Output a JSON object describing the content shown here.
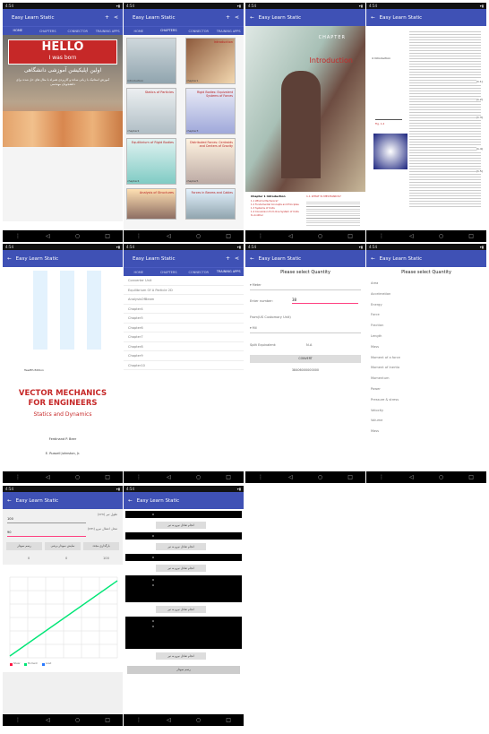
{
  "app": {
    "title": "Easy Learn Static"
  },
  "status": {
    "time": "4:54",
    "right": "▾▮"
  },
  "tabs": [
    "HOME",
    "CHAPTERS",
    "CONNECTOR",
    "TRAINING APPS"
  ],
  "home": {
    "banner_title": "HELLO",
    "banner_subtitle": "I was born",
    "farsi_title": "اولین اپلیکیشن آموزشی دانشگاهی",
    "farsi_body": "آموزش استاتیک با زبانی ساده و کاربردی همراه با مثال های حل شده برای دانشجویان مهندسی"
  },
  "chapters": {
    "items": [
      {
        "label": "Introduction",
        "cap": "chapter1"
      },
      {
        "label": "",
        "cap": "introduction"
      },
      {
        "label": "Statics of Particles",
        "cap": "chapter2"
      },
      {
        "label": "Rigid Bodies: Equivalent Systems of Forces",
        "cap": "chapter3"
      },
      {
        "label": "Equilibrium of Rigid Bodies",
        "cap": "chapter4"
      },
      {
        "label": "Distributed Forces: Centroids and Centers of Gravity",
        "cap": "chapter5"
      },
      {
        "label": "Analysis of Structures",
        "cap": "chapter6"
      },
      {
        "label": "Forces in Beams and Cables",
        "cap": "chapter7"
      }
    ]
  },
  "intro": {
    "chapter_word": "CHAPTER",
    "heading": "Introduction",
    "contents_title": "Chapter 1 Introduction",
    "contents": [
      "1.1 What Is Mechanics?",
      "1.2 Fundamental Concepts and Principles",
      "1.3 Systems of Units",
      "1.4 Conversion from One System of Units to Another"
    ],
    "section": "1.1 WHAT IS MECHANICS?"
  },
  "page4": {
    "running_head": "4   Introduction",
    "eq1": "(1.1)",
    "eq2": "(1.2)",
    "eq3": "(1.3)",
    "eq4": "(1.4)",
    "eq5": "(1.5)",
    "fig": "Fig. 1.4"
  },
  "cover": {
    "author_top": "Twelfth Edition",
    "title1": "VECTOR MECHANICS",
    "title2": "FOR ENGINEERS",
    "subtitle": "Statics and Dynamics",
    "authors": [
      "Ferdinand P. Beer",
      "E. Russell Johnston, Jr."
    ]
  },
  "converter_list": [
    "Converter Unit",
    "Equilibrium Of A Particle 2D",
    "AnalysisOfBeam",
    "Chapter4",
    "Chapter5",
    "Chapter6",
    "Chapter7",
    "Chapter8",
    "Chapter9",
    "Chapter10"
  ],
  "quantity_form": {
    "heading": "Please select Quantity",
    "unit_from": "Meter",
    "enter_number_label": "Enter number:",
    "enter_number_value": "38",
    "from_label": "From(US Customary Unit)",
    "unit_to": "Mil",
    "sign_label": "Split Equivalent:",
    "sign_value": "N.A",
    "convert": "CONVERT",
    "result": "38406000000000"
  },
  "quantity_list": {
    "heading": "Please select Quantity",
    "items": [
      "Area",
      "Acceleration",
      "Energy",
      "Force",
      "Fraction",
      "Length",
      "Mass",
      "Moment of a force",
      "Moment of Inertia",
      "Momentum",
      "Power",
      "Pressure & stress",
      "Velocity",
      "Volume",
      "Mass"
    ]
  },
  "beam": {
    "input1": "100",
    "input1_label": "طول تیر (cm)",
    "input2": "90",
    "input2_label": "محل اعمال نیرو (cm)",
    "btn1": "رسم نمودار",
    "btn2": "نمایش نمودار برشی",
    "btn3": "بارگذاری مجدد",
    "summary1": "0",
    "summary2": "0",
    "summary3": "100",
    "legend": [
      "Shear",
      "Moment",
      "Load"
    ]
  },
  "particle": {
    "btn": "انجام تعادل نیرو به تیر",
    "final": "رسم نمودار",
    "values": [
      "0",
      "0",
      "0",
      "0",
      "0",
      "0",
      "0"
    ]
  },
  "colors": {
    "primary": "#3f51b5",
    "accent": "#ff4081",
    "line": "#00e676"
  }
}
